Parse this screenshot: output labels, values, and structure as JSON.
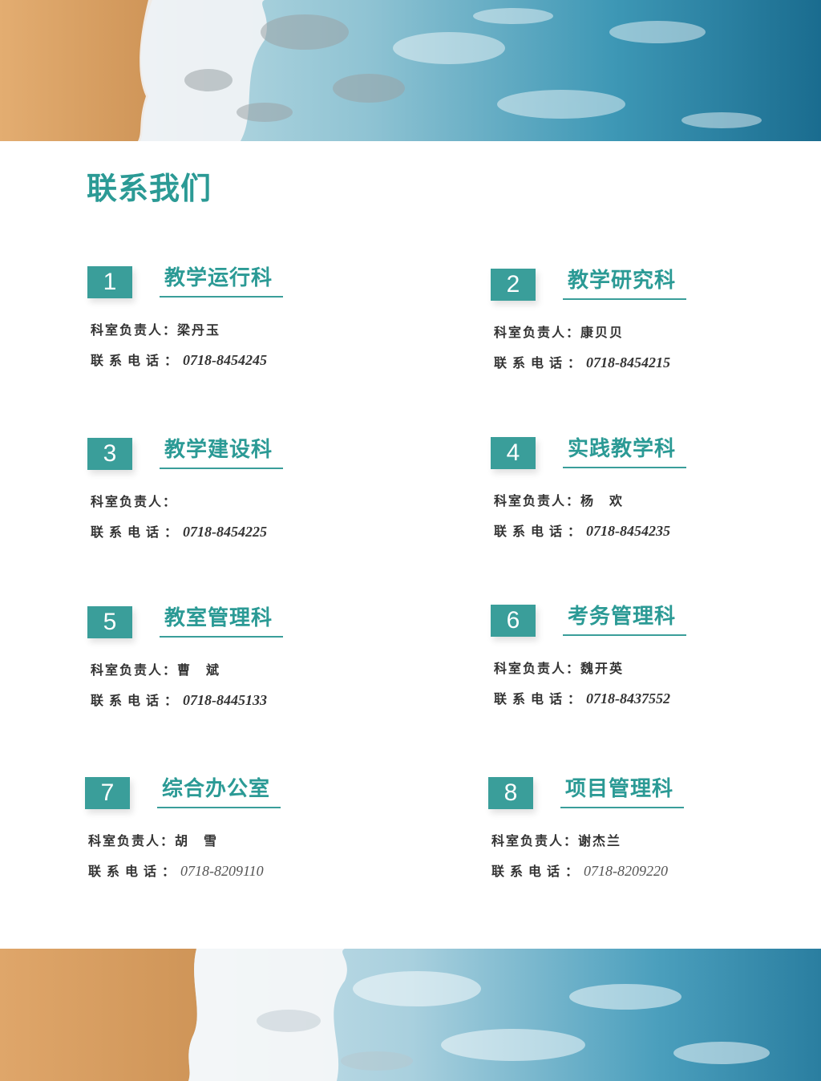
{
  "page_title": "联系我们",
  "departments": [
    {
      "number": "1",
      "name": "教学运行科",
      "head_label": "科室负责人：",
      "head": "梁丹玉",
      "phone_label": "联系电话：",
      "phone": "0718-8454245"
    },
    {
      "number": "2",
      "name": "教学研究科",
      "head_label": "科室负责人：",
      "head": "康贝贝",
      "phone_label": "联系电话：",
      "phone": "0718-8454215"
    },
    {
      "number": "3",
      "name": "教学建设科",
      "head_label": "科室负责人：",
      "head": "",
      "phone_label": "联系电话：",
      "phone": "0718-8454225"
    },
    {
      "number": "4",
      "name": "实践教学科",
      "head_label": "科室负责人：",
      "head": "杨　欢",
      "phone_label": "联系电话：",
      "phone": "0718-8454235"
    },
    {
      "number": "5",
      "name": "教室管理科",
      "head_label": "科室负责人：",
      "head": "曹　斌",
      "phone_label": "联系电话：",
      "phone": "0718-8445133"
    },
    {
      "number": "6",
      "name": "考务管理科",
      "head_label": "科室负责人：",
      "head": "魏开英",
      "phone_label": "联系电话：",
      "phone": "0718-8437552"
    },
    {
      "number": "7",
      "name": "综合办公室",
      "head_label": "科室负责人：",
      "head": "胡　雪",
      "phone_label": "联系电话：",
      "phone": "0718-8209110"
    },
    {
      "number": "8",
      "name": "项目管理科",
      "head_label": "科室负责人：",
      "head": "谢杰兰",
      "phone_label": "联系电话：",
      "phone": "0718-8209220"
    }
  ],
  "colors": {
    "accent": "#3a9e9a",
    "title": "#2b9a95",
    "sand": "#d9a066",
    "sea": "#2f86a4"
  }
}
